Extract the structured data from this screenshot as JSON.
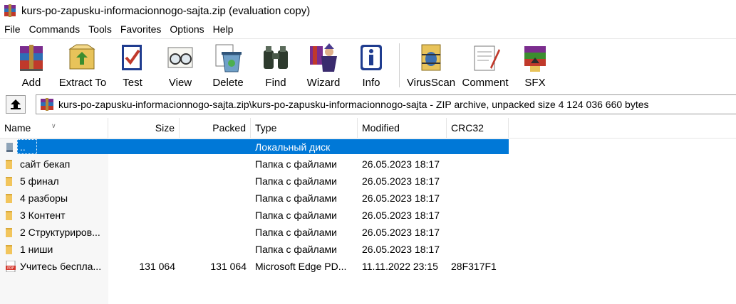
{
  "window": {
    "title": "kurs-po-zapusku-informacionnogo-sajta.zip (evaluation copy)",
    "icon": "winrar-books-icon"
  },
  "menu": [
    "File",
    "Commands",
    "Tools",
    "Favorites",
    "Options",
    "Help"
  ],
  "toolbar": [
    {
      "label": "Add",
      "icon": "add-archive-icon"
    },
    {
      "label": "Extract To",
      "icon": "extract-to-icon"
    },
    {
      "label": "Test",
      "icon": "test-icon"
    },
    {
      "label": "View",
      "icon": "view-glasses-icon"
    },
    {
      "label": "Delete",
      "icon": "delete-icon"
    },
    {
      "label": "Find",
      "icon": "find-binoculars-icon"
    },
    {
      "label": "Wizard",
      "icon": "wizard-icon"
    },
    {
      "label": "Info",
      "icon": "info-icon"
    },
    {
      "label": "VirusScan",
      "icon": "virus-scan-icon"
    },
    {
      "label": "Comment",
      "icon": "comment-icon"
    },
    {
      "label": "SFX",
      "icon": "sfx-icon"
    }
  ],
  "address": {
    "path": "kurs-po-zapusku-informacionnogo-sajta.zip\\kurs-po-zapusku-informacionnogo-sajta - ZIP archive, unpacked size 4 124 036 660 bytes"
  },
  "columns": {
    "name": "Name",
    "size": "Size",
    "packed": "Packed",
    "type": "Type",
    "modified": "Modified",
    "crc": "CRC32"
  },
  "rows": [
    {
      "name": "..",
      "size": "",
      "packed": "",
      "type": "Локальный диск",
      "modified": "",
      "crc": "",
      "icon": "drive-icon",
      "selected": true
    },
    {
      "name": "сайт бекап",
      "size": "",
      "packed": "",
      "type": "Папка с файлами",
      "modified": "26.05.2023 18:17",
      "crc": "",
      "icon": "folder-icon"
    },
    {
      "name": "5 финал",
      "size": "",
      "packed": "",
      "type": "Папка с файлами",
      "modified": "26.05.2023 18:17",
      "crc": "",
      "icon": "folder-icon"
    },
    {
      "name": "4 разборы",
      "size": "",
      "packed": "",
      "type": "Папка с файлами",
      "modified": "26.05.2023 18:17",
      "crc": "",
      "icon": "folder-icon"
    },
    {
      "name": "3 Контент",
      "size": "",
      "packed": "",
      "type": "Папка с файлами",
      "modified": "26.05.2023 18:17",
      "crc": "",
      "icon": "folder-icon"
    },
    {
      "name": "2 Структуриров...",
      "size": "",
      "packed": "",
      "type": "Папка с файлами",
      "modified": "26.05.2023 18:17",
      "crc": "",
      "icon": "folder-icon"
    },
    {
      "name": "1 ниши",
      "size": "",
      "packed": "",
      "type": "Папка с файлами",
      "modified": "26.05.2023 18:17",
      "crc": "",
      "icon": "folder-icon"
    },
    {
      "name": "Учитесь беспла...",
      "size": "131 064",
      "packed": "131 064",
      "type": "Microsoft Edge PD...",
      "modified": "11.11.2022 23:15",
      "crc": "28F317F1",
      "icon": "pdf-icon"
    }
  ],
  "colors": {
    "selection": "#0078d7",
    "folder": "#f2c55c"
  }
}
